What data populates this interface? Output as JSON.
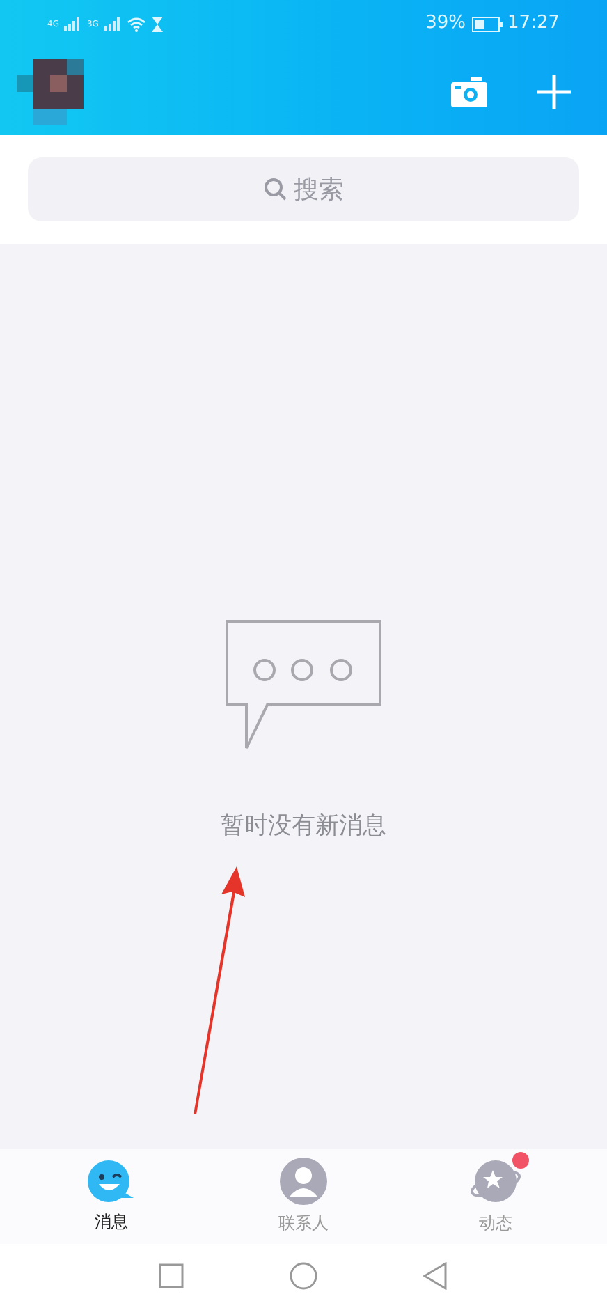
{
  "status_bar": {
    "network_1": "4G",
    "network_2": "3G",
    "battery": "39%",
    "time": "17:27"
  },
  "search": {
    "placeholder": "搜索"
  },
  "empty_state": {
    "message": "暂时没有新消息"
  },
  "tabs": [
    {
      "label": "消息",
      "kind": "messages",
      "selected": true,
      "dot": false
    },
    {
      "label": "联系人",
      "kind": "contacts",
      "selected": false,
      "dot": false
    },
    {
      "label": "动态",
      "kind": "feed",
      "selected": false,
      "dot": true
    }
  ]
}
